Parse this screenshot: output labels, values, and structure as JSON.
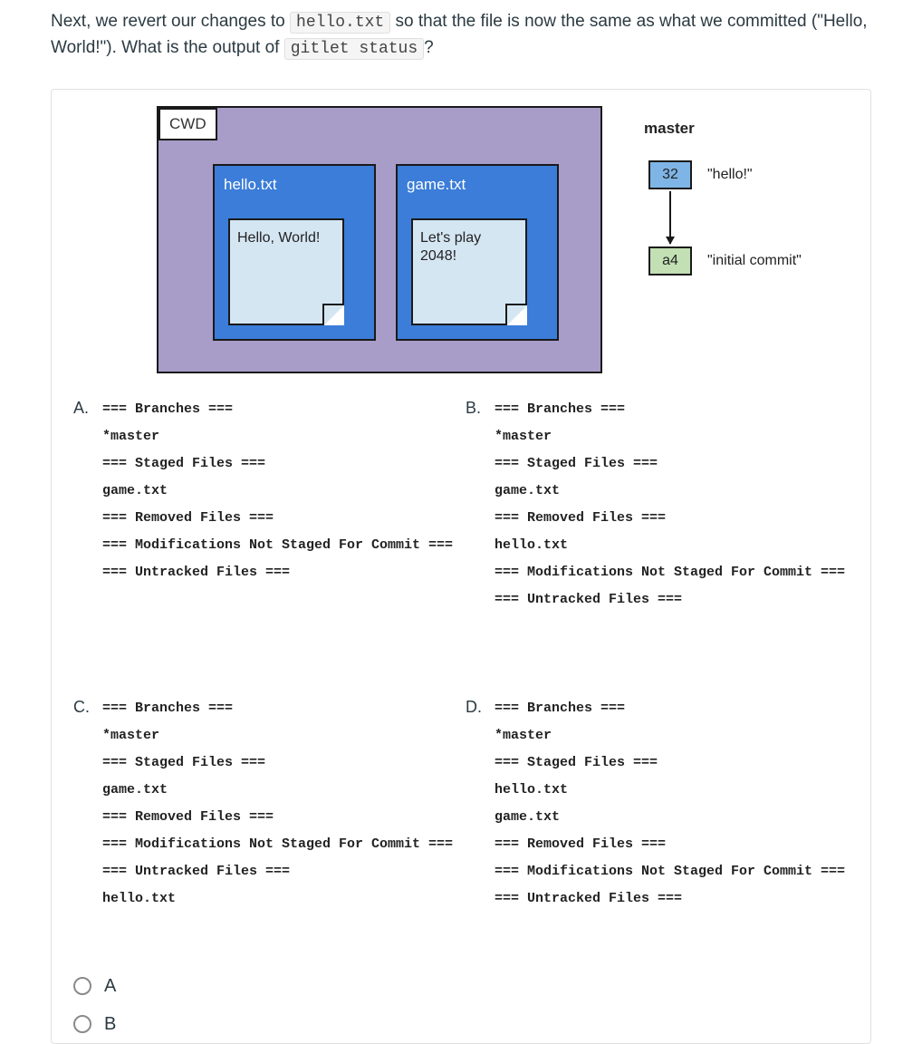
{
  "question": {
    "part1": "Next, we revert our changes to ",
    "code1": "hello.txt",
    "part2": " so that the file is now the same as what we committed (\"Hello, World!\"). What is the output of ",
    "code2": "gitlet status",
    "part3": "?"
  },
  "diagram": {
    "cwd_label": "CWD",
    "files": [
      {
        "name": "hello.txt",
        "content": "Hello, World!"
      },
      {
        "name": "game.txt",
        "content": "Let's play\n2048!"
      }
    ],
    "branch_label": "master",
    "commits": [
      {
        "id": "32",
        "message": "\"hello!\""
      },
      {
        "id": "a4",
        "message": "\"initial commit\""
      }
    ]
  },
  "options": {
    "A": {
      "letter": "A.",
      "lines": [
        "=== Branches ===",
        "*master",
        "=== Staged Files ===",
        "game.txt",
        "=== Removed Files ===",
        "=== Modifications Not Staged For Commit ===",
        "=== Untracked Files ==="
      ]
    },
    "B": {
      "letter": "B.",
      "lines": [
        "=== Branches ===",
        "*master",
        "=== Staged Files ===",
        "game.txt",
        "=== Removed Files ===",
        "hello.txt",
        "=== Modifications Not Staged For Commit ===",
        "=== Untracked Files ==="
      ]
    },
    "C": {
      "letter": "C.",
      "lines": [
        "=== Branches ===",
        "*master",
        "=== Staged Files ===",
        "game.txt",
        "=== Removed Files ===",
        "=== Modifications Not Staged For Commit ===",
        "=== Untracked Files ===",
        "hello.txt"
      ]
    },
    "D": {
      "letter": "D.",
      "lines": [
        "=== Branches ===",
        "*master",
        "=== Staged Files ===",
        "hello.txt",
        "game.txt",
        "=== Removed Files ===",
        "=== Modifications Not Staged For Commit ===",
        "=== Untracked Files ==="
      ]
    }
  },
  "radios": {
    "a": "A",
    "b": "B"
  }
}
